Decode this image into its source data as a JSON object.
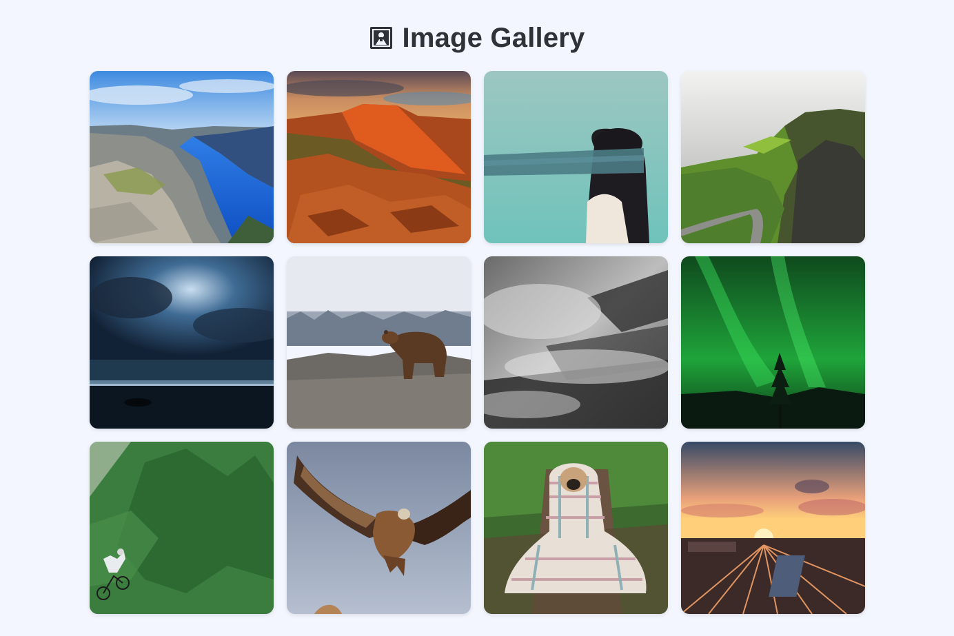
{
  "header": {
    "icon": "framed-picture-icon",
    "title": "Image Gallery"
  },
  "gallery": {
    "items": [
      {
        "subject": "fjord-cliff"
      },
      {
        "subject": "red-rock-mesa"
      },
      {
        "subject": "blindfolded-woman"
      },
      {
        "subject": "green-cliffs-road"
      },
      {
        "subject": "stormy-sea"
      },
      {
        "subject": "brown-bear"
      },
      {
        "subject": "misty-forest"
      },
      {
        "subject": "green-aurora"
      },
      {
        "subject": "forest-biker"
      },
      {
        "subject": "vulture-flight"
      },
      {
        "subject": "pug-blanket"
      },
      {
        "subject": "railyard-sunset"
      }
    ]
  }
}
